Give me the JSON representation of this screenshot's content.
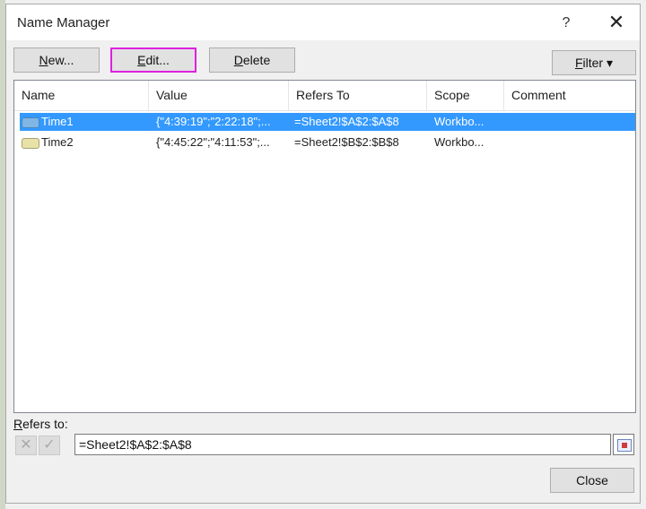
{
  "dialog": {
    "title": "Name Manager",
    "help_label": "?",
    "close_label": "✕"
  },
  "toolbar": {
    "new_pre": "",
    "new_u": "N",
    "new_post": "ew...",
    "edit_pre": "",
    "edit_u": "E",
    "edit_post": "dit...",
    "delete_pre": "",
    "delete_u": "D",
    "delete_post": "elete",
    "filter_pre": "",
    "filter_u": "F",
    "filter_post": "ilter ▾"
  },
  "list": {
    "columns": [
      "Name",
      "Value",
      "Refers To",
      "Scope",
      "Comment"
    ],
    "rows": [
      {
        "name": "Time1",
        "value": "{\"4:39:19\";\"2:22:18\";...",
        "refers_to": "=Sheet2!$A$2:$A$8",
        "scope": "Workbo...",
        "comment": ""
      },
      {
        "name": "Time2",
        "value": "{\"4:45:22\";\"4:11:53\";...",
        "refers_to": "=Sheet2!$B$2:$B$8",
        "scope": "Workbo...",
        "comment": ""
      }
    ]
  },
  "refers": {
    "label_pre": "",
    "label_u": "R",
    "label_post": "efers to:",
    "value": "=Sheet2!$A$2:$A$8",
    "cancel_glyph": "✕",
    "ok_glyph": "✓"
  },
  "footer": {
    "close_label": "Close"
  }
}
